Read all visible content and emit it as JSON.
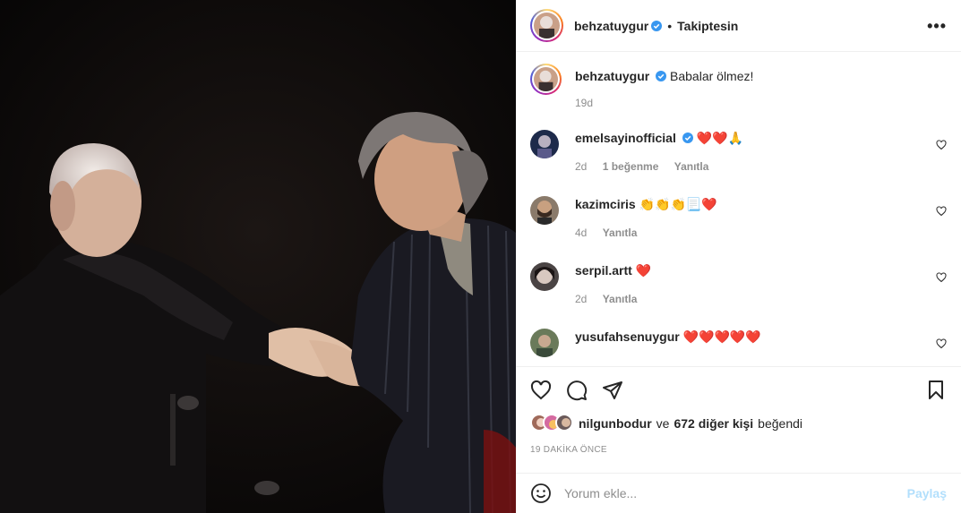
{
  "post": {
    "author": "behzatuygur",
    "follow_status": "Takiptesin",
    "dot": "•",
    "more": "•••",
    "caption": "Babalar ölmez!",
    "caption_time": "19d",
    "photo_icon": "photo-two-men-handshake"
  },
  "comments": [
    {
      "user": "emelsayinofficial",
      "verified": true,
      "text": "❤️❤️🙏",
      "time": "2d",
      "likes": "1 beğenme",
      "reply": "Yanıtla"
    },
    {
      "user": "kazimciris",
      "verified": false,
      "text": "👏👏👏📃❤️",
      "time": "4d",
      "likes": "",
      "reply": "Yanıtla"
    },
    {
      "user": "serpil.artt",
      "verified": false,
      "text": "❤️",
      "time": "2d",
      "likes": "",
      "reply": "Yanıtla"
    },
    {
      "user": "yusufahsenuygur",
      "verified": false,
      "text": "❤️❤️❤️❤️❤️"
    }
  ],
  "likes": {
    "first_user": "nilgunbodur",
    "conj": "ve",
    "others": "672 diğer kişi",
    "suffix": "beğendi"
  },
  "time_ago": "19 DAKİKA ÖNCE",
  "composer": {
    "placeholder": "Yorum ekle...",
    "post_label": "Paylaş"
  },
  "icons": [
    "heart-icon",
    "comment-icon",
    "share-icon",
    "bookmark-icon",
    "emoji-icon",
    "verified-badge-icon",
    "more-icon"
  ],
  "colors": {
    "verified": "#3897f0",
    "post_disabled": "#b2dffc",
    "meta": "#8e8e8e"
  }
}
